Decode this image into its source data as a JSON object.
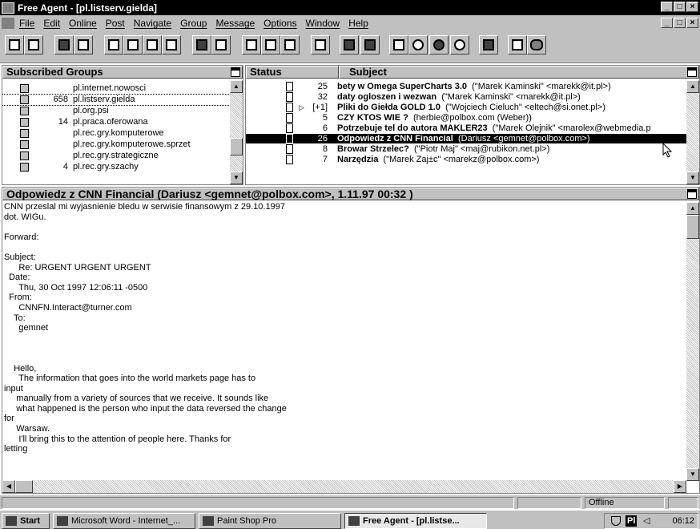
{
  "window": {
    "title": "Free Agent - [pl.listserv.gielda]",
    "controls": [
      "_",
      "□",
      "×"
    ]
  },
  "menu": {
    "items": [
      "File",
      "Edit",
      "Online",
      "Post",
      "Navigate",
      "Group",
      "Message",
      "Options",
      "Window",
      "Help"
    ]
  },
  "groups_pane": {
    "title": "Subscribed Groups",
    "rows": [
      {
        "count": "",
        "name": "pl.internet.nowosci"
      },
      {
        "count": "658",
        "name": "pl.listserv.gielda"
      },
      {
        "count": "",
        "name": "pl.org.psi"
      },
      {
        "count": "14",
        "name": "pl.praca.oferowana"
      },
      {
        "count": "",
        "name": "pl.rec.gry.komputerowe"
      },
      {
        "count": "",
        "name": "pl.rec.gry.komputerowe.sprzet"
      },
      {
        "count": "",
        "name": "pl.rec.gry.strategiczne"
      },
      {
        "count": "4",
        "name": "pl.rec.gry.szachy"
      }
    ]
  },
  "articles_pane": {
    "status_header": "Status",
    "subject_header": "Subject",
    "rows": [
      {
        "marker": "",
        "lines": "25",
        "subject": "bety w Omega SuperCharts 3.0",
        "author": "(\"Marek Kaminski\" <marekk@it.pl>)"
      },
      {
        "marker": "",
        "lines": "32",
        "subject": "daty ogloszen i wezwan",
        "author": "(\"Marek Kaminski\" <marekk@it.pl>)"
      },
      {
        "marker": "▷",
        "lines": "[+1]",
        "subject": "Pliki  do  Giełda GOLD 1.0",
        "author": "(\"Wojciech Cieluch\" <eltech@si.onet.pl>)"
      },
      {
        "marker": "",
        "lines": "5",
        "subject": "CZY KTOS WIE ?",
        "author": "(herbie@polbox.com (Weber))"
      },
      {
        "marker": "",
        "lines": "6",
        "subject": "Potrzebuje tel do autora MAKLER23",
        "author": "(\"Marek Olejnik\" <marolex@webmedia.p"
      },
      {
        "marker": "",
        "lines": "26",
        "subject": "Odpowiedz z CNN Financial",
        "author": "(Dariusz <gemnet@polbox.com>)"
      },
      {
        "marker": "",
        "lines": "8",
        "subject": "Browar Strzelec?",
        "author": "(\"Piotr Maj\" <maj@rubikon.net.pl>)"
      },
      {
        "marker": "",
        "lines": "7",
        "subject": "Narzędzia",
        "author": "(\"Marek Zaj±c\" <marekz@polbox.com>)"
      }
    ]
  },
  "message": {
    "header": "Odpowiedz z CNN Financial (Dariusz <gemnet@polbox.com>, 1.11.97 00:32 )",
    "body": "CNN przeslal mi wyjasnienie bledu w serwisie finansowym z 29.10.1997\ndot. WIGu.\n\nForward:\n\nSubject:\n      Re: URGENT URGENT URGENT\n  Date:\n      Thu, 30 Oct 1997 12:06:11 -0500\n  From:\n      CNNFN.Interact@turner.com\n    To:\n      gemnet\n\n\n\n    Hello,\n      The information that goes into the world markets page has to\ninput\n     manually from a variety of sources that we receive. It sounds like\n     what happened is the person who input the data reversed the change\nfor\n     Warsaw.\n      I'll bring this to the attention of people here. Thanks for\nletting"
  },
  "statusbar": {
    "text": "",
    "mode": "Offline"
  },
  "taskbar": {
    "start": "Start",
    "buttons": [
      "Microsoft Word - Internet_...",
      "Paint Shop Pro",
      "Free Agent - [pl.listse..."
    ],
    "tray_lang": "Pl",
    "clock": "06:12"
  }
}
